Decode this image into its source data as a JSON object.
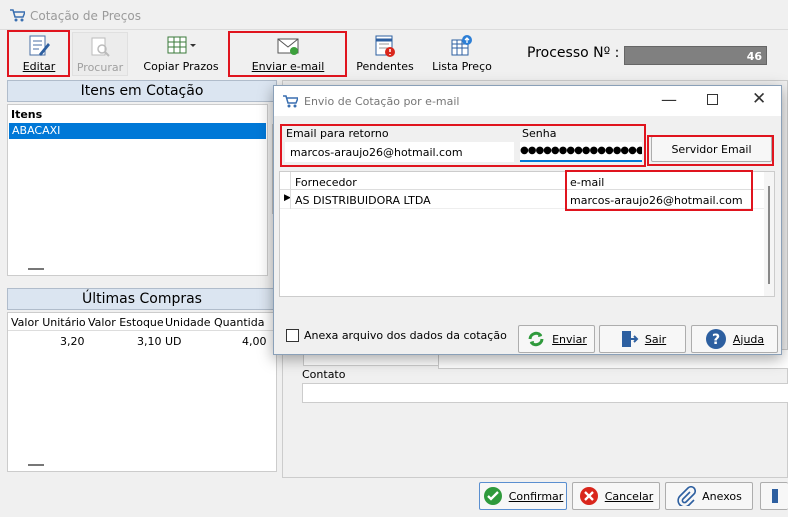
{
  "window": {
    "title": "Cotação de Preços"
  },
  "toolbar": {
    "editar": "Editar",
    "procurar": "Procurar",
    "copiar": "Copiar Prazos",
    "enviar": "Enviar e-mail",
    "pendentes": "Pendentes",
    "lista": "Lista Preço",
    "processo_label": "Processo Nº :",
    "processo_value": "46"
  },
  "itens": {
    "header": "Itens em Cotação",
    "col": "Itens",
    "rows": [
      "ABACAXI"
    ]
  },
  "compras": {
    "header": "Últimas Compras",
    "cols": [
      "Valor Unitário",
      "Valor Estoque",
      "Unidade",
      "Quantida"
    ],
    "row": [
      "3,20",
      "3,10",
      "UD",
      "4,00"
    ]
  },
  "dialog": {
    "title": "Envio de Cotação por e-mail",
    "email_label": "Email para retorno",
    "email_value": "marcos-araujo26@hotmail.com",
    "senha_label": "Senha",
    "senha_value": "●●●●●●●●●●●●●●●●●",
    "servidor": "Servidor Email",
    "cols": [
      "Fornecedor",
      "e-mail"
    ],
    "row": [
      "AS DISTRIBUIDORA LTDA",
      "marcos-araujo26@hotmail.com"
    ],
    "anexa": "Anexa arquivo dos dados da cotação",
    "enviar": "Enviar",
    "sair": "Sair",
    "ajuda": "Ajuda"
  },
  "right": {
    "contato": "Contato"
  },
  "bottom": {
    "confirmar": "Confirmar",
    "cancelar": "Cancelar",
    "anexos": "Anexos"
  },
  "colors": {
    "selection": "#0078d7",
    "accent_red": "#e0141e",
    "panel_header": "#dbe5f1"
  }
}
